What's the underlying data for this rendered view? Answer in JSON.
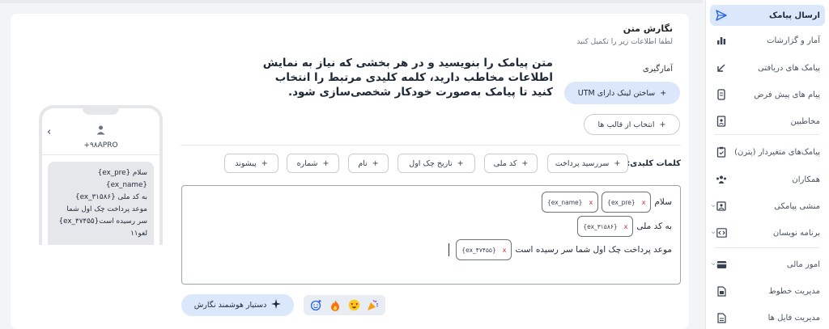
{
  "sidebar": {
    "items": [
      {
        "label": "ارسال پیامک",
        "icon": "send-icon",
        "active": true
      },
      {
        "label": "آمار و گزارشات",
        "icon": "bar-chart-icon"
      },
      {
        "label": "پیامک های دریافتی",
        "icon": "arrow-down-left-icon"
      },
      {
        "label": "پیام های پیش فرض",
        "icon": "phone-message-icon"
      },
      {
        "label": "مخاطبین",
        "icon": "contact-card-icon"
      },
      {
        "label": "پیامک‌های متغیردار (پترن)",
        "icon": "pattern-clipboard-icon"
      },
      {
        "label": "همکاران",
        "icon": "team-icon"
      },
      {
        "label": "منشی پیامکی",
        "icon": "assistant-icon"
      },
      {
        "label": "برنامه نویسان",
        "icon": "code-icon"
      },
      {
        "label": "امور مالی",
        "icon": "wallet-icon"
      },
      {
        "label": "مدیریت خطوط",
        "icon": "sim-icon"
      },
      {
        "label": "مدیریت فایل ها",
        "icon": "file-icon"
      }
    ]
  },
  "compose": {
    "title": "نگارش متن",
    "subtitle": "لطفا اطلاعات زیر را تکمیل کنید",
    "section_label": "آمارگیری",
    "help_text": "متن پیامک را بنویسید و در هر بخشی که نیاز به نمایش اطلاعات مخاطب دارید، کلمه کلیدی مرتبط را انتخاب کنید تا پیامک به‌صورت خودکار شخصی‌سازی شود.",
    "utm_button": "ساختن لینک دارای UTM",
    "template_button": "انتخاب از قالب ها",
    "keywords_label": "کلمات کلیدی:",
    "keywords": [
      "سررسید پرداخت",
      "کد ملی",
      "تاریخ چک اول",
      "نام",
      "شماره",
      "پیشوند"
    ],
    "editor": {
      "line1_text": "سلام",
      "line1_tags": [
        "{ex_pre}",
        "{ex_name}"
      ],
      "line2_text": "به کد ملی",
      "line2_tags": [
        "{ex_۳۱۵۸۶}"
      ],
      "line3_text": "موعد پرداخت چک اول شما سر رسیده است",
      "line3_tags": [
        "{ex_۴۷۴۵۵}"
      ],
      "tag_remove": "x"
    },
    "assistant_button": "دستیار هوشمند نگارش",
    "plus": "+"
  },
  "preview": {
    "sender": "+۹۸APRO",
    "message_lines": [
      "سلام {ex_pre} {ex_name}",
      "به کد ملی {ex_۳۱۵۸۶}",
      "موعد پرداخت چک اول شما",
      "سر رسیده است{ex_۴۷۴۵۵}",
      "لغو۱۱"
    ]
  }
}
